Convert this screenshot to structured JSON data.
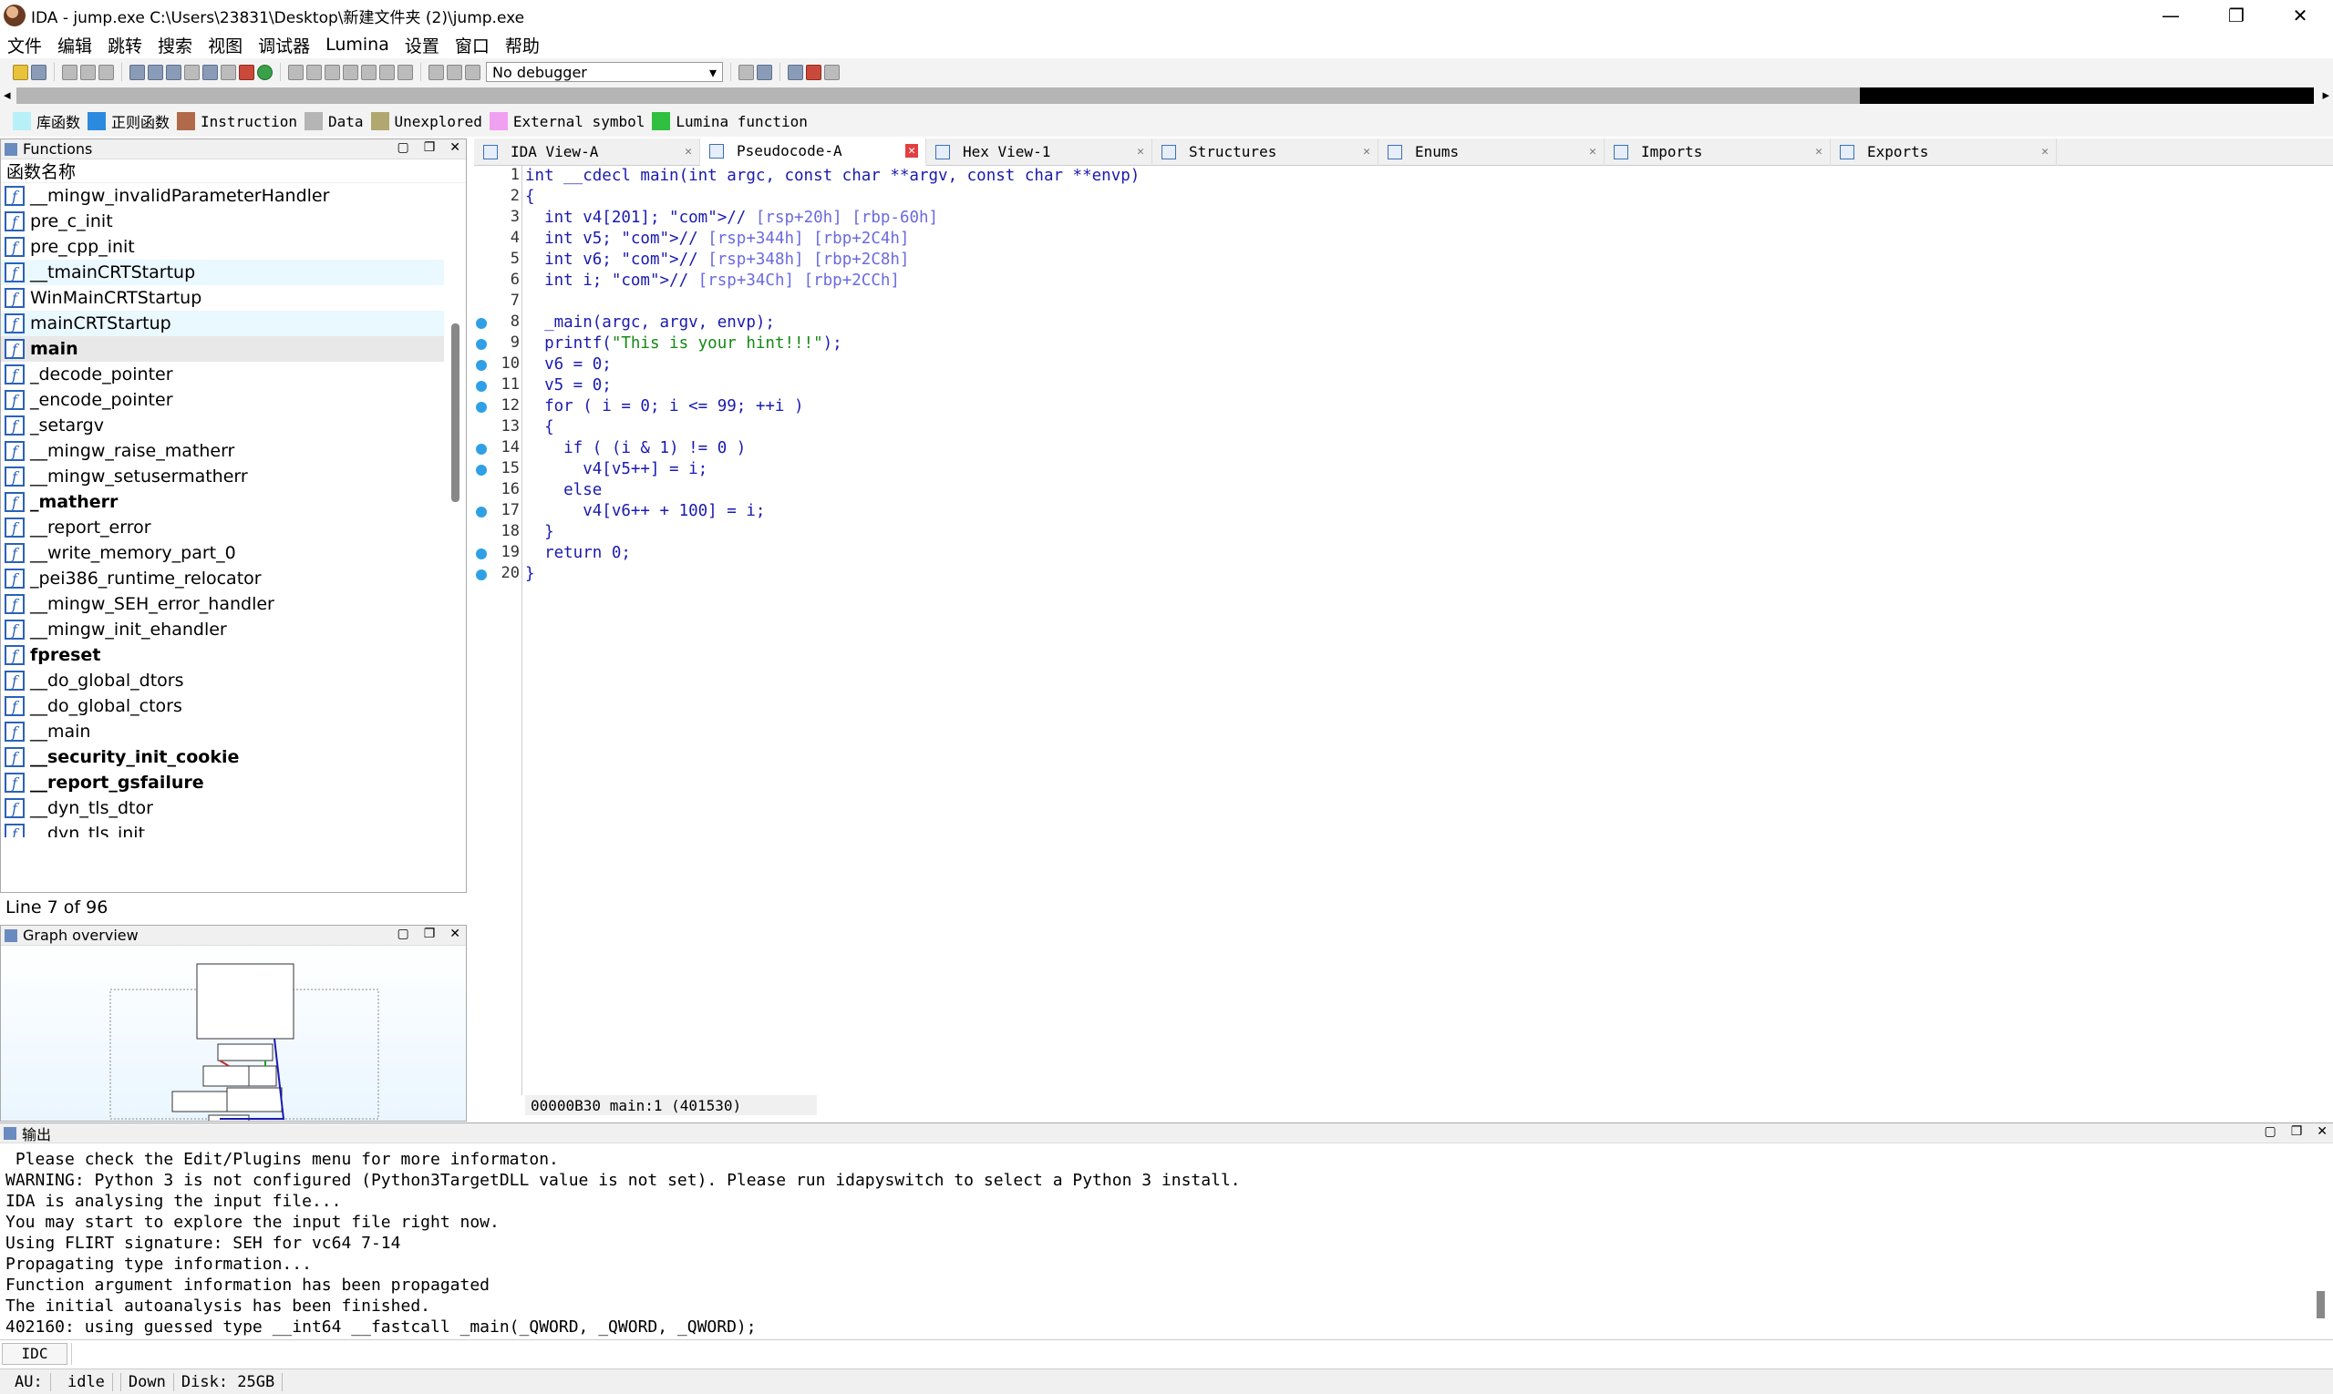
{
  "window": {
    "title": "IDA - jump.exe C:\\Users\\23831\\Desktop\\新建文件夹 (2)\\jump.exe",
    "minimize": "—",
    "maximize": "❐",
    "close": "✕"
  },
  "menu": [
    "文件",
    "编辑",
    "跳转",
    "搜索",
    "视图",
    "调试器",
    "Lumina",
    "设置",
    "窗口",
    "帮助"
  ],
  "toolbar": {
    "debugger": "No debugger"
  },
  "legend": [
    {
      "label": "库函数",
      "color": "#b8f0f8"
    },
    {
      "label": "正则函数",
      "color": "#2a8ae0"
    },
    {
      "label": "Instruction",
      "color": "#b06a4a"
    },
    {
      "label": "Data",
      "color": "#b5b5b5"
    },
    {
      "label": "Unexplored",
      "color": "#b0a870"
    },
    {
      "label": "External symbol",
      "color": "#f0a0f0"
    },
    {
      "label": "Lumina function",
      "color": "#30c040"
    }
  ],
  "functions": {
    "title": "Functions",
    "column": "函数名称",
    "items": [
      {
        "name": "__mingw_invalidParameterHandler",
        "style": ""
      },
      {
        "name": "pre_c_init",
        "style": ""
      },
      {
        "name": "pre_cpp_init",
        "style": ""
      },
      {
        "name": "__tmainCRTStartup",
        "style": "hl"
      },
      {
        "name": "WinMainCRTStartup",
        "style": ""
      },
      {
        "name": "mainCRTStartup",
        "style": "hl"
      },
      {
        "name": "main",
        "style": "sel bold"
      },
      {
        "name": "_decode_pointer",
        "style": ""
      },
      {
        "name": "_encode_pointer",
        "style": ""
      },
      {
        "name": "_setargv",
        "style": ""
      },
      {
        "name": "__mingw_raise_matherr",
        "style": ""
      },
      {
        "name": "__mingw_setusermatherr",
        "style": ""
      },
      {
        "name": "_matherr",
        "style": "bold"
      },
      {
        "name": "__report_error",
        "style": ""
      },
      {
        "name": "__write_memory_part_0",
        "style": ""
      },
      {
        "name": "_pei386_runtime_relocator",
        "style": ""
      },
      {
        "name": "__mingw_SEH_error_handler",
        "style": ""
      },
      {
        "name": "__mingw_init_ehandler",
        "style": ""
      },
      {
        "name": "fpreset",
        "style": "bold"
      },
      {
        "name": "__do_global_dtors",
        "style": ""
      },
      {
        "name": "__do_global_ctors",
        "style": ""
      },
      {
        "name": "__main",
        "style": ""
      },
      {
        "name": "__security_init_cookie",
        "style": "bold"
      },
      {
        "name": "__report_gsfailure",
        "style": "bold"
      },
      {
        "name": "__dyn_tls_dtor",
        "style": ""
      },
      {
        "name": "__dyn_tls_init",
        "style": ""
      }
    ],
    "status": "Line 7 of 96"
  },
  "graph": {
    "title": "Graph overview"
  },
  "tabs": [
    {
      "label": "IDA View-A",
      "active": false
    },
    {
      "label": "Pseudocode-A",
      "active": true
    },
    {
      "label": "Hex View-1",
      "active": false
    },
    {
      "label": "Structures",
      "active": false
    },
    {
      "label": "Enums",
      "active": false
    },
    {
      "label": "Imports",
      "active": false
    },
    {
      "label": "Exports",
      "active": false
    }
  ],
  "code": {
    "lines": [
      {
        "n": "1",
        "dot": false,
        "html": "int __cdecl main(int argc, const char **argv, const char **envp)"
      },
      {
        "n": "2",
        "dot": false,
        "html": "{"
      },
      {
        "n": "3",
        "dot": false,
        "html": "  int v4[201]; // [rsp+20h] [rbp-60h]"
      },
      {
        "n": "4",
        "dot": false,
        "html": "  int v5; // [rsp+344h] [rbp+2C4h]"
      },
      {
        "n": "5",
        "dot": false,
        "html": "  int v6; // [rsp+348h] [rbp+2C8h]"
      },
      {
        "n": "6",
        "dot": false,
        "html": "  int i; // [rsp+34Ch] [rbp+2CCh]"
      },
      {
        "n": "7",
        "dot": false,
        "html": ""
      },
      {
        "n": "8",
        "dot": true,
        "html": "  _main(argc, argv, envp);"
      },
      {
        "n": "9",
        "dot": true,
        "html": "  printf(\"This is your hint!!!\");"
      },
      {
        "n": "10",
        "dot": true,
        "html": "  v6 = 0;"
      },
      {
        "n": "11",
        "dot": true,
        "html": "  v5 = 0;"
      },
      {
        "n": "12",
        "dot": true,
        "html": "  for ( i = 0; i <= 99; ++i )"
      },
      {
        "n": "13",
        "dot": false,
        "html": "  {"
      },
      {
        "n": "14",
        "dot": true,
        "html": "    if ( (i & 1) != 0 )"
      },
      {
        "n": "15",
        "dot": true,
        "html": "      v4[v5++] = i;"
      },
      {
        "n": "16",
        "dot": false,
        "html": "    else"
      },
      {
        "n": "17",
        "dot": true,
        "html": "      v4[v6++ + 100] = i;"
      },
      {
        "n": "18",
        "dot": false,
        "html": "  }"
      },
      {
        "n": "19",
        "dot": true,
        "html": "  return 0;"
      },
      {
        "n": "20",
        "dot": true,
        "html": "}"
      }
    ],
    "status": "00000B30 main:1 (401530)"
  },
  "output": {
    "title": "输出",
    "lines": [
      " Please check the Edit/Plugins menu for more informaton.",
      "WARNING: Python 3 is not configured (Python3TargetDLL value is not set). Please run idapyswitch to select a Python 3 install.",
      "IDA is analysing the input file...",
      "You may start to explore the input file right now.",
      "Using FLIRT signature: SEH for vc64 7-14",
      "Propagating type information...",
      "Function argument information has been propagated",
      "The initial autoanalysis has been finished.",
      "402160: using guessed type __int64 __fastcall _main(_QWORD, _QWORD, _QWORD);"
    ],
    "idc": "IDC"
  },
  "statusbar": {
    "au": "AU:",
    "state": "idle",
    "dir": "Down",
    "disk": "Disk: 25GB"
  }
}
